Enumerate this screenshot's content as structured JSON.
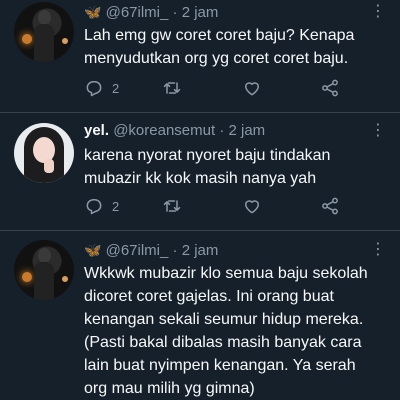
{
  "tweets": [
    {
      "name": "",
      "emoji": "🦋",
      "handle": "@67ilmi_",
      "separator": "·",
      "time": "2 jam",
      "lines": [
        "Lah emg gw coret coret baju? Kenapa",
        "menyudutkan org yg coret coret baju."
      ],
      "reply_count": "2"
    },
    {
      "name": "yel.",
      "emoji": "",
      "handle": "@koreansemut",
      "separator": "·",
      "time": "2 jam",
      "lines": [
        "karena nyorat nyoret baju tindakan",
        "mubazir kk kok masih nanya yah"
      ],
      "reply_count": "2"
    },
    {
      "name": "",
      "emoji": "🦋",
      "handle": "@67ilmi_",
      "separator": "·",
      "time": "2 jam",
      "lines": [
        "Wkkwk mubazir klo semua baju sekolah",
        "dicoret coret gajelas. Ini orang buat",
        "kenangan sekali seumur hidup mereka.",
        "(Pasti bakal dibalas masih banyak cara",
        "lain buat nyimpen kenangan. Ya serah",
        "org mau milih yg gimna)"
      ]
    }
  ],
  "icons": {
    "more": "more-vertical-icon",
    "reply": "reply-icon",
    "retweet": "retweet-icon",
    "like": "heart-icon",
    "share": "share-icon"
  },
  "colors": {
    "background": "#15202b",
    "text": "#f7f9f9",
    "muted": "#8b98a5",
    "divider": "#38444d"
  }
}
